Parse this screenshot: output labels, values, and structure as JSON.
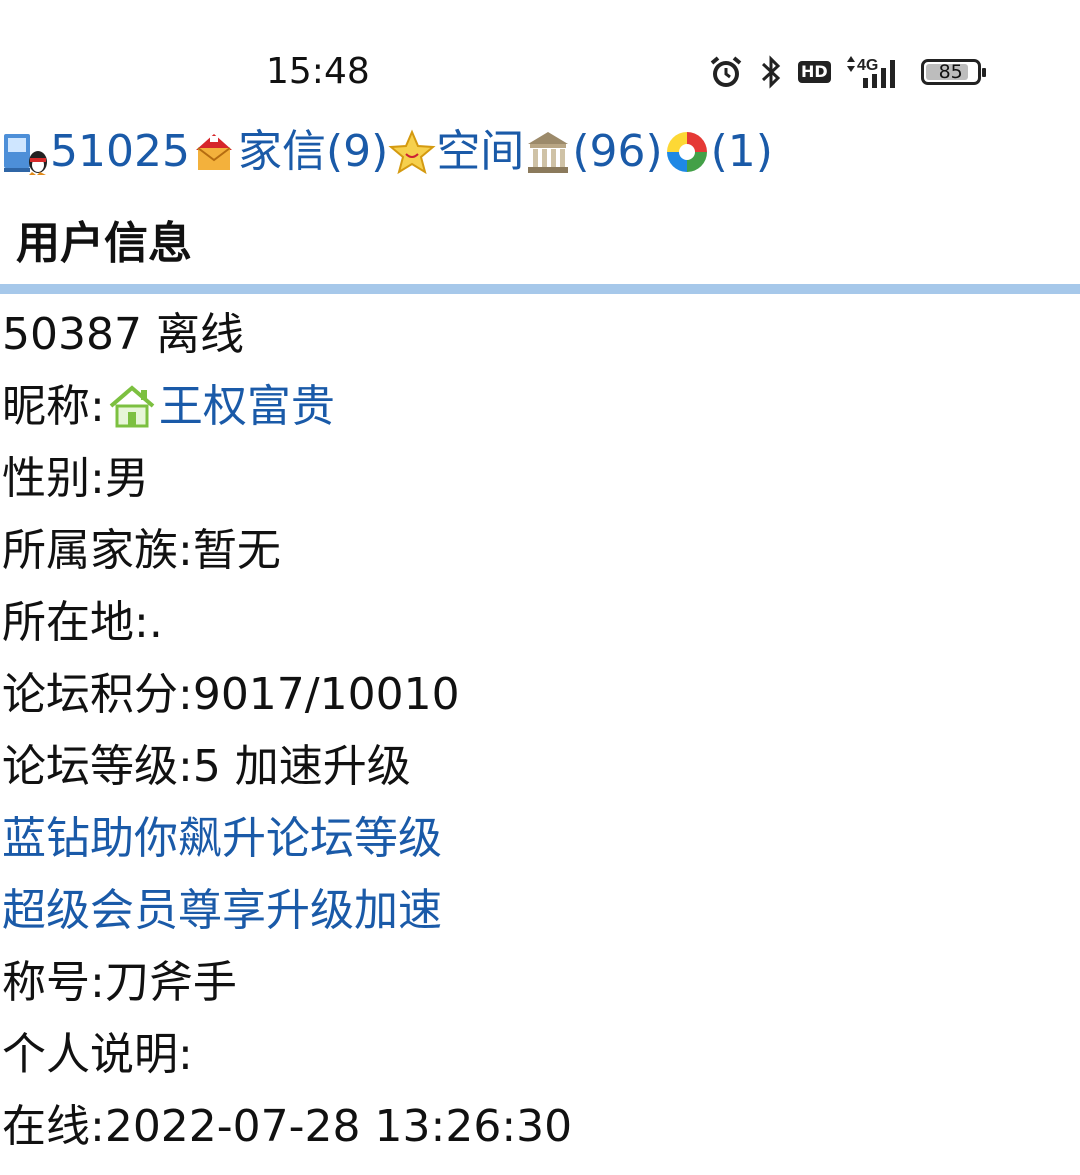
{
  "status_bar": {
    "time": "15:48",
    "icons": [
      "alarm-icon",
      "bluetooth-icon",
      "hd-icon",
      "4g-signal-icon",
      "battery-icon"
    ],
    "hd_label": "HD",
    "network_label": "4G",
    "battery_level": 85,
    "battery_text": "85"
  },
  "nav": {
    "user_id": "51025",
    "mail_label": "家信(9)",
    "space_label": "空间",
    "bank_label": "(96)",
    "album_label": "(1)"
  },
  "page": {
    "section_title": "用户信息"
  },
  "profile": {
    "status_line": "50387 离线",
    "nickname_label": "昵称:",
    "nickname_value": "王权富贵",
    "gender": "性别:男",
    "family": "所属家族:暂无",
    "location": "所在地:.",
    "forum_points": "论坛积分:9017/10010",
    "forum_level_text": "论坛等级:5 加速升级",
    "blue_diamond_link": "蓝钻助你飙升论坛等级",
    "super_member_link": "超级会员尊享升级加速",
    "title": "称号:刀斧手",
    "bio": "个人说明:",
    "online_time": "在线:2022-07-28 13:26:30"
  }
}
